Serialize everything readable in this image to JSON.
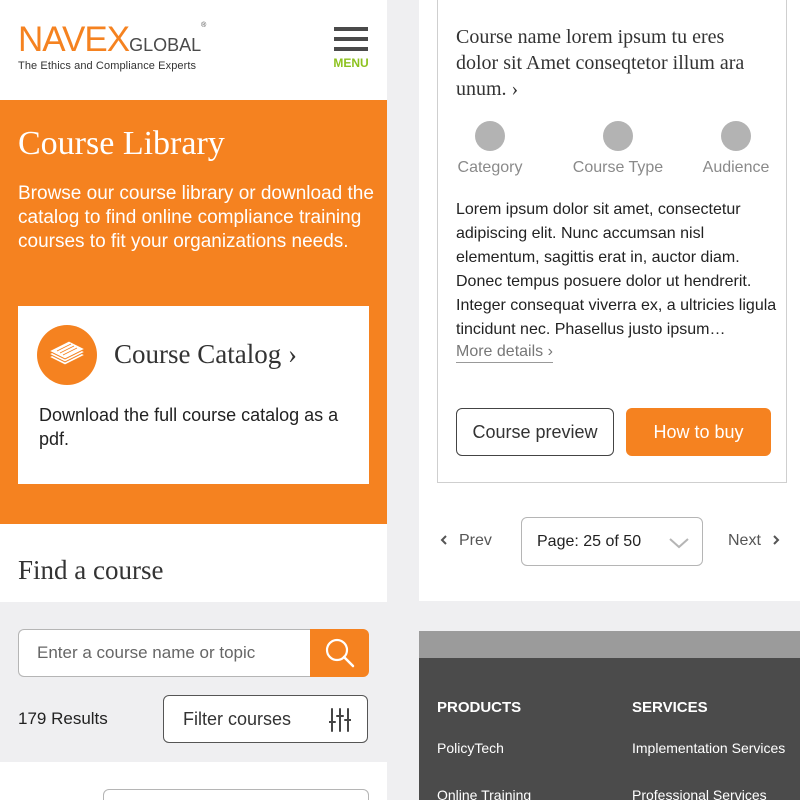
{
  "header": {
    "logo_navex": "NAVEX",
    "logo_global": "GLOBAL",
    "logo_reg": "®",
    "logo_tagline": "The Ethics and Compliance Experts",
    "menu_label": "MENU"
  },
  "hero": {
    "title": "Course Library",
    "description": "Browse our course library or download the catalog to find online compliance training courses to fit your organizations needs.",
    "catalog": {
      "title": "Course Catalog ›",
      "description": "Download the full course catalog as a pdf."
    }
  },
  "find": {
    "heading": "Find a course",
    "search_placeholder": "Enter a course name or topic",
    "results": "179 Results",
    "filter_label": "Filter courses"
  },
  "course": {
    "name": "Course name lorem ipsum tu eres dolor sit Amet conseqtetor illum ara unum. ›",
    "meta": [
      "Category",
      "Course Type",
      "Audience"
    ],
    "description": "Lorem ipsum dolor sit amet, consectetur adipiscing elit. Nunc accumsan nisl elementum, sagittis erat in, auctor diam. Donec tempus posuere dolor ut hendrerit. Integer consequat viverra ex, a ultricies ligula tincidunt nec. Phasellus justo ipsum…",
    "more": "More details ›",
    "preview_label": "Course preview",
    "buy_label": "How to buy"
  },
  "pagination": {
    "prev": "Prev",
    "page": "Page: 25 of 50",
    "next": "Next"
  },
  "footer": {
    "products_heading": "PRODUCTS",
    "services_heading": "SERVICES",
    "products": [
      "PolicyTech",
      "Online Training"
    ],
    "services": [
      "Implementation Services",
      "Professional Services"
    ]
  },
  "colors": {
    "brand_orange": "#f58220",
    "menu_green": "#8dc21f",
    "footer_dark": "#4b4b4b"
  },
  "icons": [
    "hamburger-menu-icon",
    "document-stack-icon",
    "search-icon",
    "sliders-icon",
    "chevron-down-icon",
    "chevron-left-icon",
    "chevron-right-icon"
  ]
}
